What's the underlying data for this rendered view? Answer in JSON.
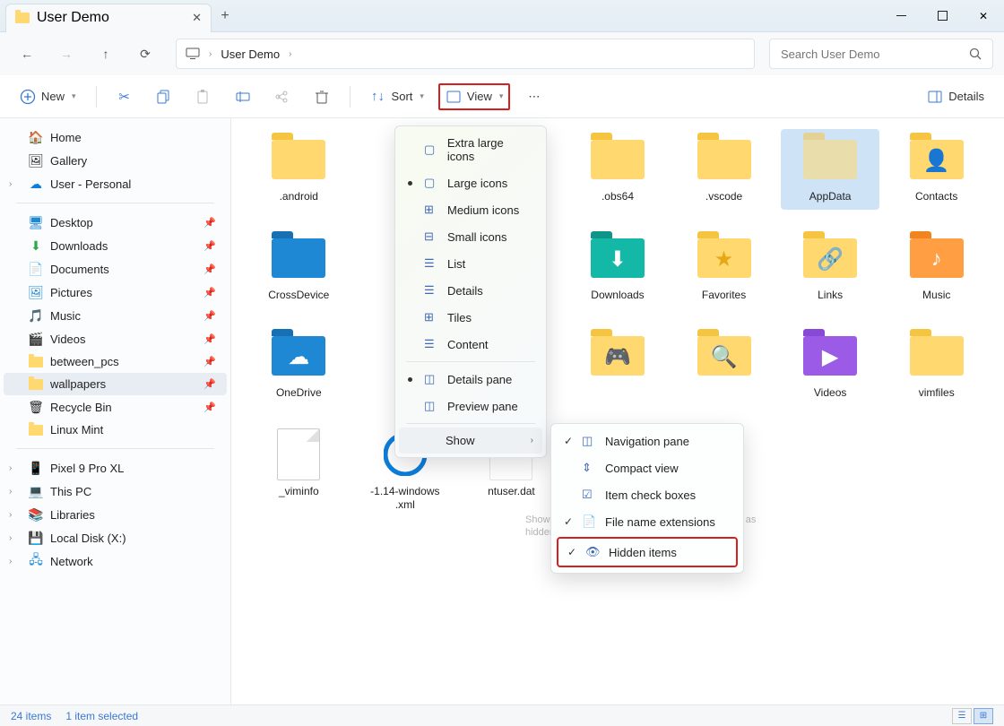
{
  "titlebar": {
    "tab_title": "User Demo"
  },
  "addressbar": {
    "segment": "User Demo"
  },
  "search": {
    "placeholder": "Search User Demo"
  },
  "toolbar": {
    "new": "New",
    "sort": "Sort",
    "view": "View",
    "details": "Details"
  },
  "sidebar": {
    "home": "Home",
    "gallery": "Gallery",
    "user_personal": "User - Personal",
    "desktop": "Desktop",
    "downloads": "Downloads",
    "documents": "Documents",
    "pictures": "Pictures",
    "music": "Music",
    "videos": "Videos",
    "between_pcs": "between_pcs",
    "wallpapers": "wallpapers",
    "recycle_bin": "Recycle Bin",
    "linux_mint": "Linux Mint",
    "pixel": "Pixel 9 Pro XL",
    "this_pc": "This PC",
    "libraries": "Libraries",
    "local_disk": "Local Disk (X:)",
    "network": "Network"
  },
  "files": {
    "android": ".android",
    "obs64": ".obs64",
    "vscode": ".vscode",
    "appdata": "AppData",
    "contacts": "Contacts",
    "crossdevice": "CrossDevice",
    "downloads": "Downloads",
    "favorites": "Favorites",
    "links": "Links",
    "music": "Music",
    "onedrive": "OneDrive",
    "videos": "Videos",
    "vimfiles": "vimfiles",
    "viminfo": "_viminfo",
    "xml_file": "-1.14-windows\n.xml",
    "ntuser": "ntuser.dat"
  },
  "viewmenu": {
    "xl_icons": "Extra large icons",
    "large_icons": "Large icons",
    "medium_icons": "Medium icons",
    "small_icons": "Small icons",
    "list": "List",
    "details": "Details",
    "tiles": "Tiles",
    "content": "Content",
    "details_pane": "Details pane",
    "preview_pane": "Preview pane",
    "show": "Show"
  },
  "submenu": {
    "nav_pane": "Navigation pane",
    "compact_view": "Compact view",
    "item_checkboxes": "Item check boxes",
    "file_ext": "File name extensions",
    "hidden_items": "Hidden items"
  },
  "tooltip": "Show or hide the files and folders that are marked as hidden.",
  "statusbar": {
    "count": "24 items",
    "selected": "1 item selected"
  }
}
